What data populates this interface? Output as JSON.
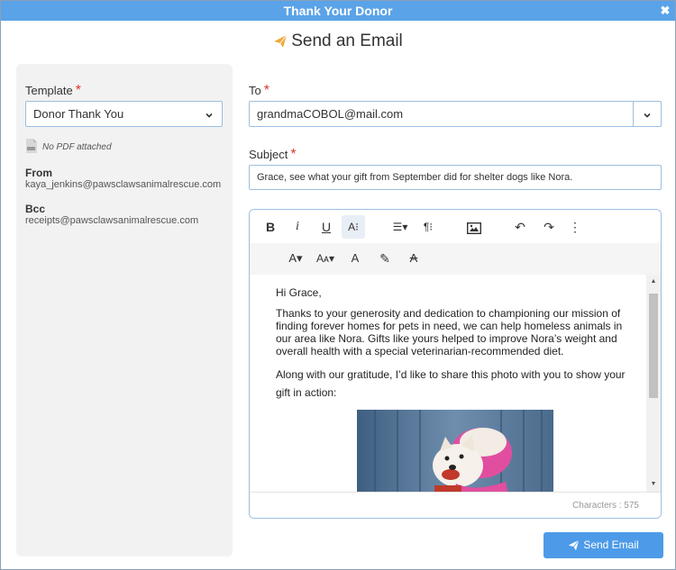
{
  "window": {
    "title": "Thank Your Donor",
    "close_glyph": "✖"
  },
  "heading": {
    "text": "Send an Email",
    "icon": "paper-plane-icon",
    "icon_color": "#f0a83a"
  },
  "template": {
    "label": "Template",
    "required_mark": "*",
    "value": "Donor Thank You"
  },
  "pdf": {
    "text": "No PDF attached",
    "icon": "pdf-file-icon"
  },
  "from": {
    "label": "From",
    "value": "kaya_jenkins@pawsclawsanimalrescue.com"
  },
  "bcc": {
    "label": "Bcc",
    "value": "receipts@pawsclawsanimalrescue.com"
  },
  "to": {
    "label": "To",
    "required_mark": "*",
    "value": "grandmaCOBOL@mail.com"
  },
  "subject": {
    "label": "Subject",
    "required_mark": "*",
    "value": "Grace, see what your gift from September did for shelter dogs like Nora."
  },
  "toolbar": {
    "row1": [
      {
        "name": "bold-button",
        "glyph": "B"
      },
      {
        "name": "italic-button",
        "glyph": "i"
      },
      {
        "name": "underline-button",
        "glyph": "U"
      },
      {
        "name": "more-text-button",
        "glyph": "A⁝"
      },
      {
        "name": "align-button",
        "glyph": "☰▾"
      },
      {
        "name": "paragraph-format-button",
        "glyph": "¶⁝"
      },
      {
        "name": "insert-image-button",
        "glyph": "image"
      },
      {
        "name": "undo-button",
        "glyph": "↶"
      },
      {
        "name": "redo-button",
        "glyph": "↷"
      },
      {
        "name": "more-options-button",
        "glyph": "⋮"
      }
    ],
    "row2": [
      {
        "name": "font-family-button",
        "glyph": "A▾"
      },
      {
        "name": "font-size-button",
        "glyph": "Aᴀ▾"
      },
      {
        "name": "text-color-button",
        "glyph": "A"
      },
      {
        "name": "highlight-button",
        "glyph": "✎"
      },
      {
        "name": "clear-format-button",
        "glyph": "A̸"
      }
    ]
  },
  "body": {
    "greeting": "Hi Grace,",
    "p1": "Thanks to your generosity and dedication to championing our mission of finding forever homes for pets in need, we can help homeless animals in our area like Nora. Gifts like yours helped to improve Nora’s weight and overall health with a special veterinarian-recommended diet.",
    "p2": "Along with our gratitude, I’d like to share this photo with you to show your gift in action:"
  },
  "footer": {
    "chars": "Characters : 575"
  },
  "send_button": {
    "label": "Send Email"
  },
  "colors": {
    "accent": "#4d9be8",
    "title_bar": "#5aa3e8",
    "required": "#e03434"
  }
}
